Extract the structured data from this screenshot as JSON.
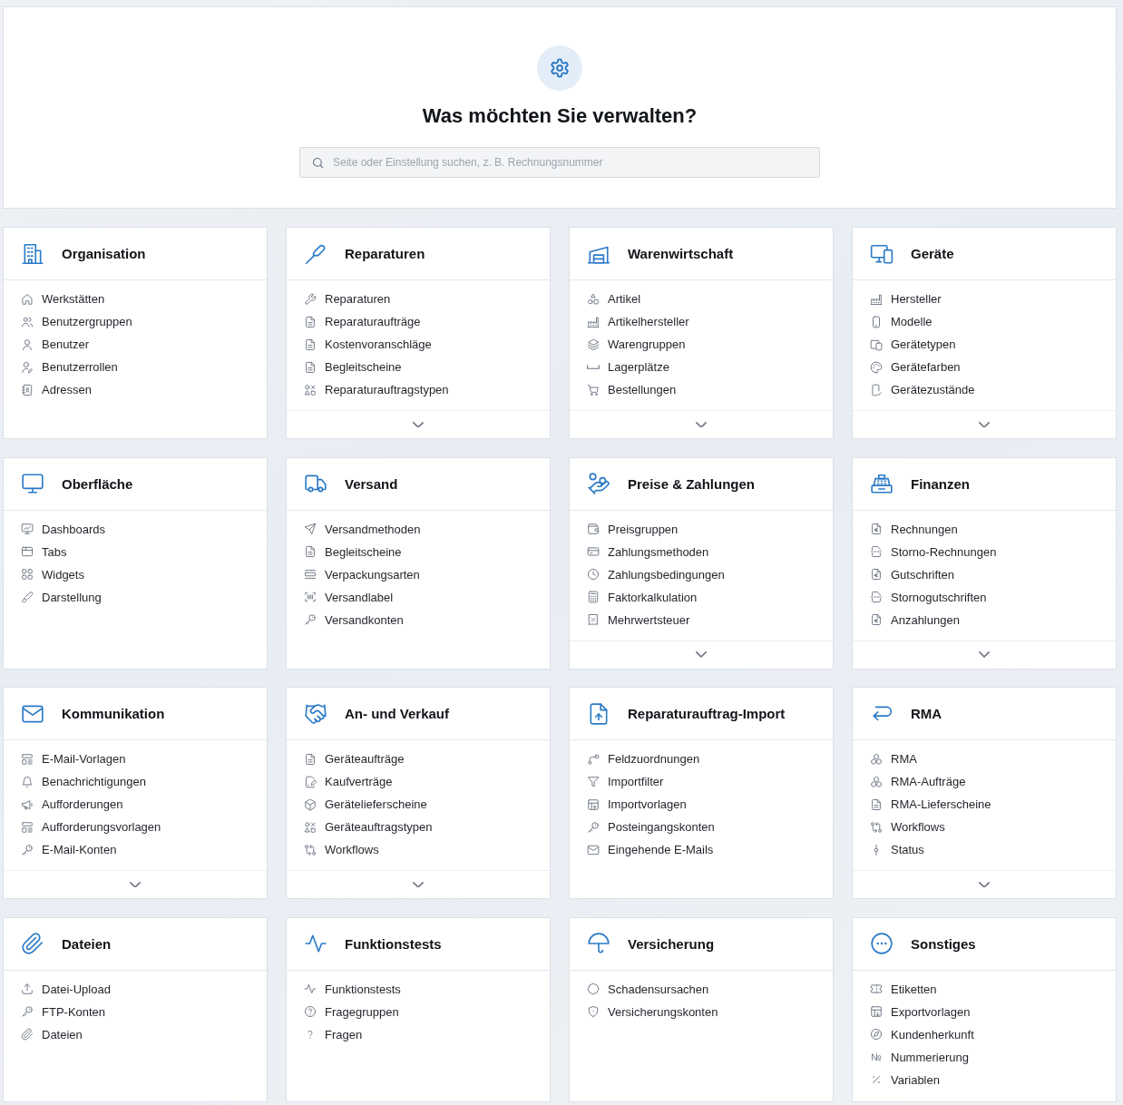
{
  "header": {
    "title": "Was möchten Sie verwalten?",
    "search": {
      "placeholder": "Seite oder Einstellung suchen, z. B. Rechnungsnummer"
    }
  },
  "sections": [
    {
      "title": "Organisation",
      "items": [
        {
          "label": "Werkstätten"
        },
        {
          "label": "Benutzergruppen"
        },
        {
          "label": "Benutzer"
        },
        {
          "label": "Benutzerrollen"
        },
        {
          "label": "Adressen"
        }
      ],
      "expandable": false
    },
    {
      "title": "Reparaturen",
      "items": [
        {
          "label": "Reparaturen"
        },
        {
          "label": "Reparaturaufträge"
        },
        {
          "label": "Kostenvoranschläge"
        },
        {
          "label": "Begleitscheine"
        },
        {
          "label": "Reparaturauftragstypen"
        }
      ],
      "expandable": true
    },
    {
      "title": "Warenwirtschaft",
      "items": [
        {
          "label": "Artikel"
        },
        {
          "label": "Artikelhersteller"
        },
        {
          "label": "Warengruppen"
        },
        {
          "label": "Lagerplätze"
        },
        {
          "label": "Bestellungen"
        }
      ],
      "expandable": true
    },
    {
      "title": "Geräte",
      "items": [
        {
          "label": "Hersteller"
        },
        {
          "label": "Modelle"
        },
        {
          "label": "Gerätetypen"
        },
        {
          "label": "Gerätefarben"
        },
        {
          "label": "Gerätezustände"
        }
      ],
      "expandable": true
    },
    {
      "title": "Oberfläche",
      "items": [
        {
          "label": "Dashboards"
        },
        {
          "label": "Tabs"
        },
        {
          "label": "Widgets"
        },
        {
          "label": "Darstellung"
        }
      ],
      "expandable": false
    },
    {
      "title": "Versand",
      "items": [
        {
          "label": "Versandmethoden"
        },
        {
          "label": "Begleitscheine"
        },
        {
          "label": "Verpackungsarten"
        },
        {
          "label": "Versandlabel"
        },
        {
          "label": "Versandkonten"
        }
      ],
      "expandable": false
    },
    {
      "title": "Preise & Zahlungen",
      "items": [
        {
          "label": "Preisgruppen"
        },
        {
          "label": "Zahlungsmethoden"
        },
        {
          "label": "Zahlungsbedingungen"
        },
        {
          "label": "Faktorkalkulation"
        },
        {
          "label": "Mehrwertsteuer"
        }
      ],
      "expandable": true
    },
    {
      "title": "Finanzen",
      "items": [
        {
          "label": "Rechnungen"
        },
        {
          "label": "Storno-Rechnungen"
        },
        {
          "label": "Gutschriften"
        },
        {
          "label": "Stornogutschriften"
        },
        {
          "label": "Anzahlungen"
        }
      ],
      "expandable": true
    },
    {
      "title": "Kommunikation",
      "items": [
        {
          "label": "E-Mail-Vorlagen"
        },
        {
          "label": "Benachrichtigungen"
        },
        {
          "label": "Aufforderungen"
        },
        {
          "label": "Aufforderungsvorlagen"
        },
        {
          "label": "E-Mail-Konten"
        }
      ],
      "expandable": true
    },
    {
      "title": "An- und Verkauf",
      "items": [
        {
          "label": "Geräteaufträge"
        },
        {
          "label": "Kaufverträge"
        },
        {
          "label": "Gerätelieferscheine"
        },
        {
          "label": "Geräteauftragstypen"
        },
        {
          "label": "Workflows"
        }
      ],
      "expandable": true
    },
    {
      "title": "Reparaturauftrag-Import",
      "items": [
        {
          "label": "Feldzuordnungen"
        },
        {
          "label": "Importfilter"
        },
        {
          "label": "Importvorlagen"
        },
        {
          "label": "Posteingangskonten"
        },
        {
          "label": "Eingehende E-Mails"
        }
      ],
      "expandable": false
    },
    {
      "title": "RMA",
      "items": [
        {
          "label": "RMA"
        },
        {
          "label": "RMA-Aufträge"
        },
        {
          "label": "RMA-Lieferscheine"
        },
        {
          "label": "Workflows"
        },
        {
          "label": "Status"
        }
      ],
      "expandable": true
    },
    {
      "title": "Dateien",
      "items": [
        {
          "label": "Datei-Upload"
        },
        {
          "label": "FTP-Konten"
        },
        {
          "label": "Dateien"
        }
      ],
      "expandable": false
    },
    {
      "title": "Funktionstests",
      "items": [
        {
          "label": "Funktionstests"
        },
        {
          "label": "Fragegruppen"
        },
        {
          "label": "Fragen"
        }
      ],
      "expandable": false
    },
    {
      "title": "Versicherung",
      "items": [
        {
          "label": "Schadensursachen"
        },
        {
          "label": "Versicherungskonten"
        }
      ],
      "expandable": false
    },
    {
      "title": "Sonstiges",
      "items": [
        {
          "label": "Etiketten"
        },
        {
          "label": "Exportvorlagen"
        },
        {
          "label": "Kundenherkunft"
        },
        {
          "label": "Nummerierung",
          "glyph": "№"
        },
        {
          "label": "Variablen"
        }
      ],
      "expandable": false
    }
  ]
}
